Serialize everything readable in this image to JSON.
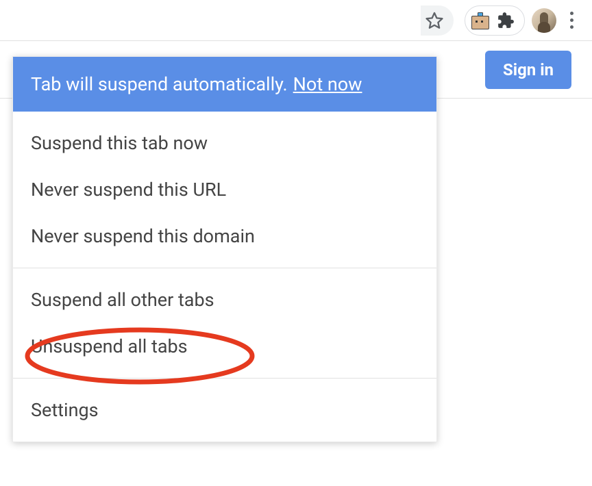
{
  "toolbar": {
    "star_title": "Bookmark",
    "extension_title": "The Great Suspender",
    "extensions_title": "Extensions",
    "profile_title": "Profile",
    "more_title": "More"
  },
  "page": {
    "signin_label": "Sign in"
  },
  "dropdown": {
    "header_text": "Tab will suspend automatically.",
    "header_link": "Not now",
    "section1": [
      "Suspend this tab now",
      "Never suspend this URL",
      "Never suspend this domain"
    ],
    "section2": [
      "Suspend all other tabs",
      "Unsuspend all tabs"
    ],
    "section3": [
      "Settings"
    ]
  },
  "annotation": {
    "highlight_target": "Unsuspend all tabs"
  }
}
